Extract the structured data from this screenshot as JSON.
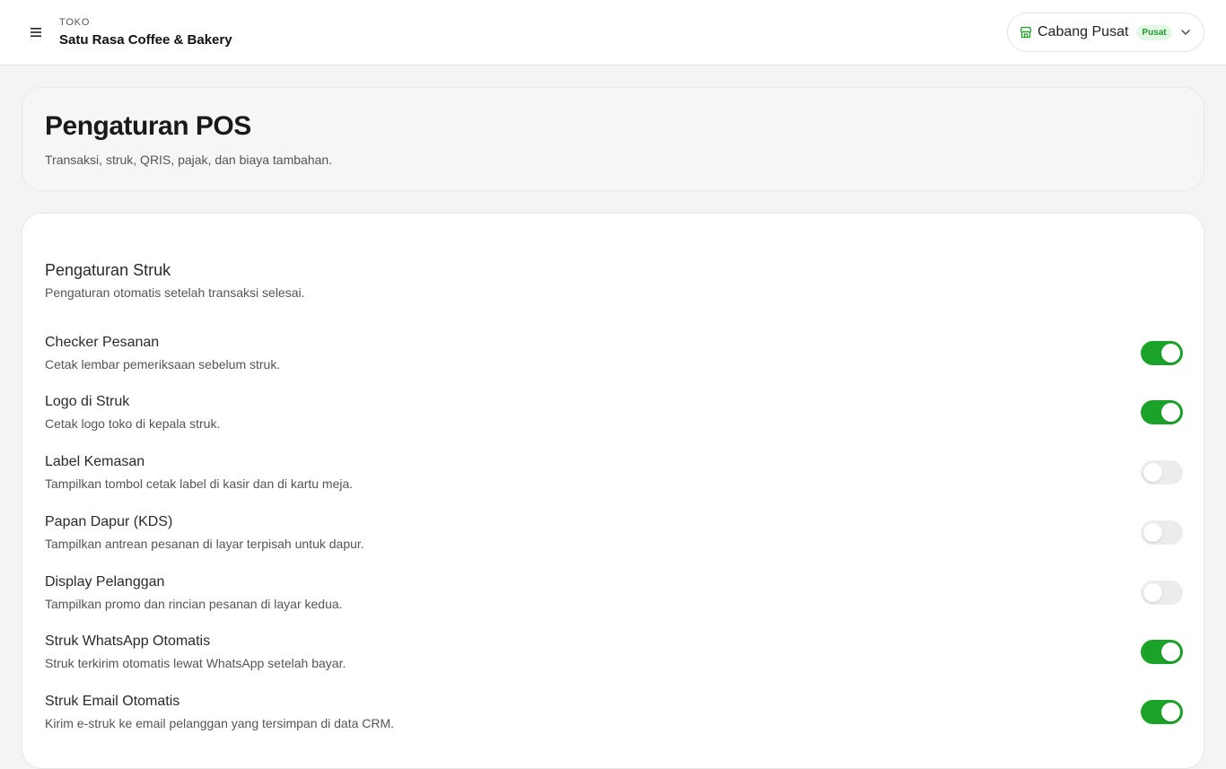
{
  "topbar": {
    "store_kicker": "TOKO",
    "store_name": "Satu Rasa Coffee & Bakery",
    "branch": {
      "label": "Cabang Pusat",
      "badge": "Pusat"
    }
  },
  "header": {
    "title": "Pengaturan POS",
    "subtitle": "Transaksi, struk, QRIS, pajak, dan biaya tambahan."
  },
  "receipt_settings": {
    "title": "Pengaturan Struk",
    "description": "Pengaturan otomatis setelah transaksi selesai.",
    "items": [
      {
        "title": "Checker Pesanan",
        "description": "Cetak lembar pemeriksaan sebelum struk.",
        "enabled": true
      },
      {
        "title": "Logo di Struk",
        "description": "Cetak logo toko di kepala struk.",
        "enabled": true
      },
      {
        "title": "Label Kemasan",
        "description": "Tampilkan tombol cetak label di kasir dan di kartu meja.",
        "enabled": false
      },
      {
        "title": "Papan Dapur (KDS)",
        "description": "Tampilkan antrean pesanan di layar terpisah untuk dapur.",
        "enabled": false
      },
      {
        "title": "Display Pelanggan",
        "description": "Tampilkan promo dan rincian pesanan di layar kedua.",
        "enabled": false
      },
      {
        "title": "Struk WhatsApp Otomatis",
        "description": "Struk terkirim otomatis lewat WhatsApp setelah bayar.",
        "enabled": true
      },
      {
        "title": "Struk Email Otomatis",
        "description": "Kirim e-struk ke email pelanggan yang tersimpan di data CRM.",
        "enabled": true
      }
    ]
  },
  "colors": {
    "toggle_on": "#1aa328",
    "toggle_off": "#ececec",
    "badge_bg": "#e3f7e5",
    "badge_text": "#1e9b2e"
  }
}
